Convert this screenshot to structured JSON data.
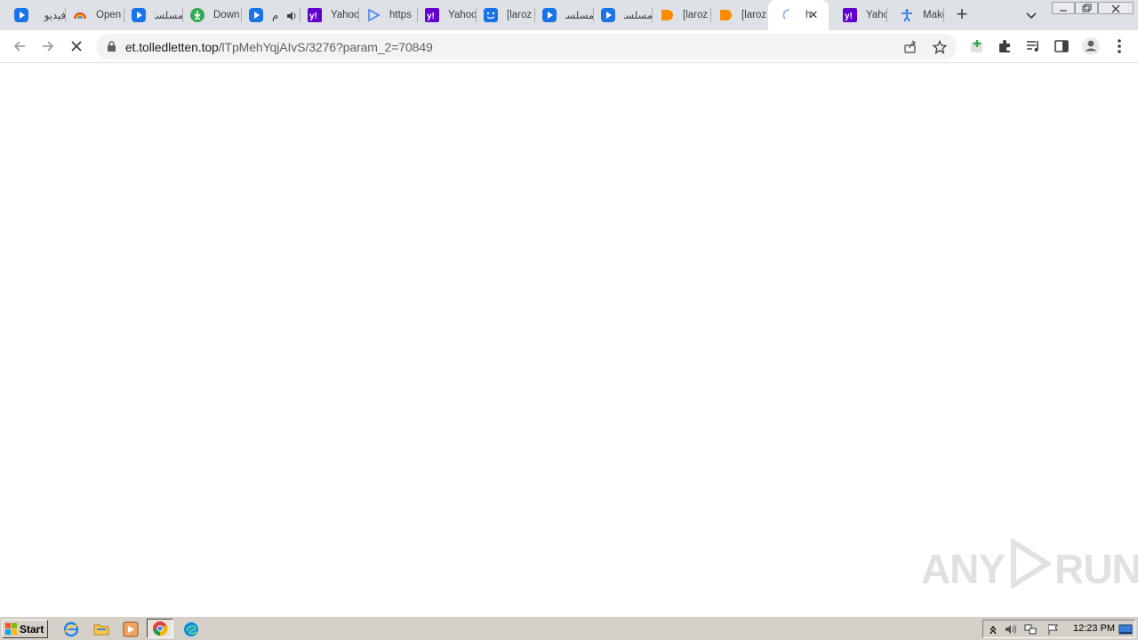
{
  "tabs": [
    {
      "title": "فيديو",
      "icon": "play-icon"
    },
    {
      "title": "Open",
      "icon": "rainbow-icon"
    },
    {
      "title": "مسلسل",
      "icon": "play-icon"
    },
    {
      "title": "Down",
      "icon": "download-icon"
    },
    {
      "title": "م",
      "icon": "play-icon",
      "audio": true
    },
    {
      "title": "Yahoo",
      "icon": "yahoo-icon"
    },
    {
      "title": "https",
      "icon": "play-outline-icon"
    },
    {
      "title": "Yahoo",
      "icon": "yahoo-icon"
    },
    {
      "title": "[laroz",
      "icon": "smile-icon"
    },
    {
      "title": "مسلسل",
      "icon": "play-icon"
    },
    {
      "title": "مسلسل",
      "icon": "play-icon"
    },
    {
      "title": "[laroz",
      "icon": "orange-icon"
    },
    {
      "title": "[laroz",
      "icon": "orange-icon"
    },
    {
      "title": "h",
      "icon": "loading-icon",
      "active": true
    },
    {
      "title": "Yahoo",
      "icon": "yahoo-icon"
    },
    {
      "title": "Make",
      "icon": "accessibility-icon"
    }
  ],
  "toolbar": {
    "url_host": "et.tolledletten.top",
    "url_path": "/lTpMehYqjAIvS/3276?param_2=70849"
  },
  "watermark": {
    "left": "ANY",
    "right": "RUN"
  },
  "taskbar": {
    "start_label": "Start",
    "clock": "12:23 PM"
  },
  "colors": {
    "tabstrip_bg": "#dee1e6",
    "omnibox_bg": "#f1f3f4",
    "taskbar_bg": "#d4d0c8",
    "yahoo_purple": "#6001d2",
    "play_blue": "#1a73e8"
  }
}
